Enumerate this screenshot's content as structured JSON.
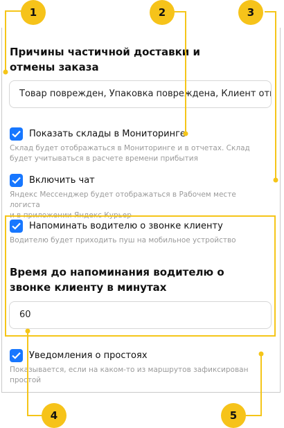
{
  "section_title": "Причины частичной доставки и отмены заказа",
  "section_title_line1": "Причины частичной доставки и",
  "section_title_line2": "отмены заказа",
  "reasons_field_value": "Товар поврежден, Упаковка повреждена, Клиент отк",
  "options": [
    {
      "label": "Показать склады в Мониторинге",
      "checked": true,
      "hint_line1": "Склад будет отображаться в Мониторинге и в отчетах. Склад",
      "hint_line2": "будет учитываться в расчете времени прибытия"
    },
    {
      "label": "Включить чат",
      "checked": true,
      "hint_line1": "Яндекс Мессенджер будет отображаться в Рабочем месте логиста",
      "hint_line2": "и в приложении Яндекс Курьер"
    },
    {
      "label": "Напоминать водителю о звонке клиенту",
      "checked": true,
      "hint_line1": "Водителю будет приходить пуш на мобильное устройство"
    },
    {
      "label": "Уведомления о простоях",
      "checked": true,
      "hint_line1": "Показывается, если на каком-то из маршрутов зафиксирован",
      "hint_line2": "простой"
    }
  ],
  "reminder_title_line1": "Время до напоминания водителю о",
  "reminder_title_line2": "звонке клиенту в минутах",
  "reminder_minutes_value": "60",
  "markers": [
    "1",
    "2",
    "3",
    "4",
    "5"
  ],
  "colors": {
    "checkbox": "#1777ff",
    "highlight": "#f5c518",
    "marker": "#f6c31a"
  }
}
